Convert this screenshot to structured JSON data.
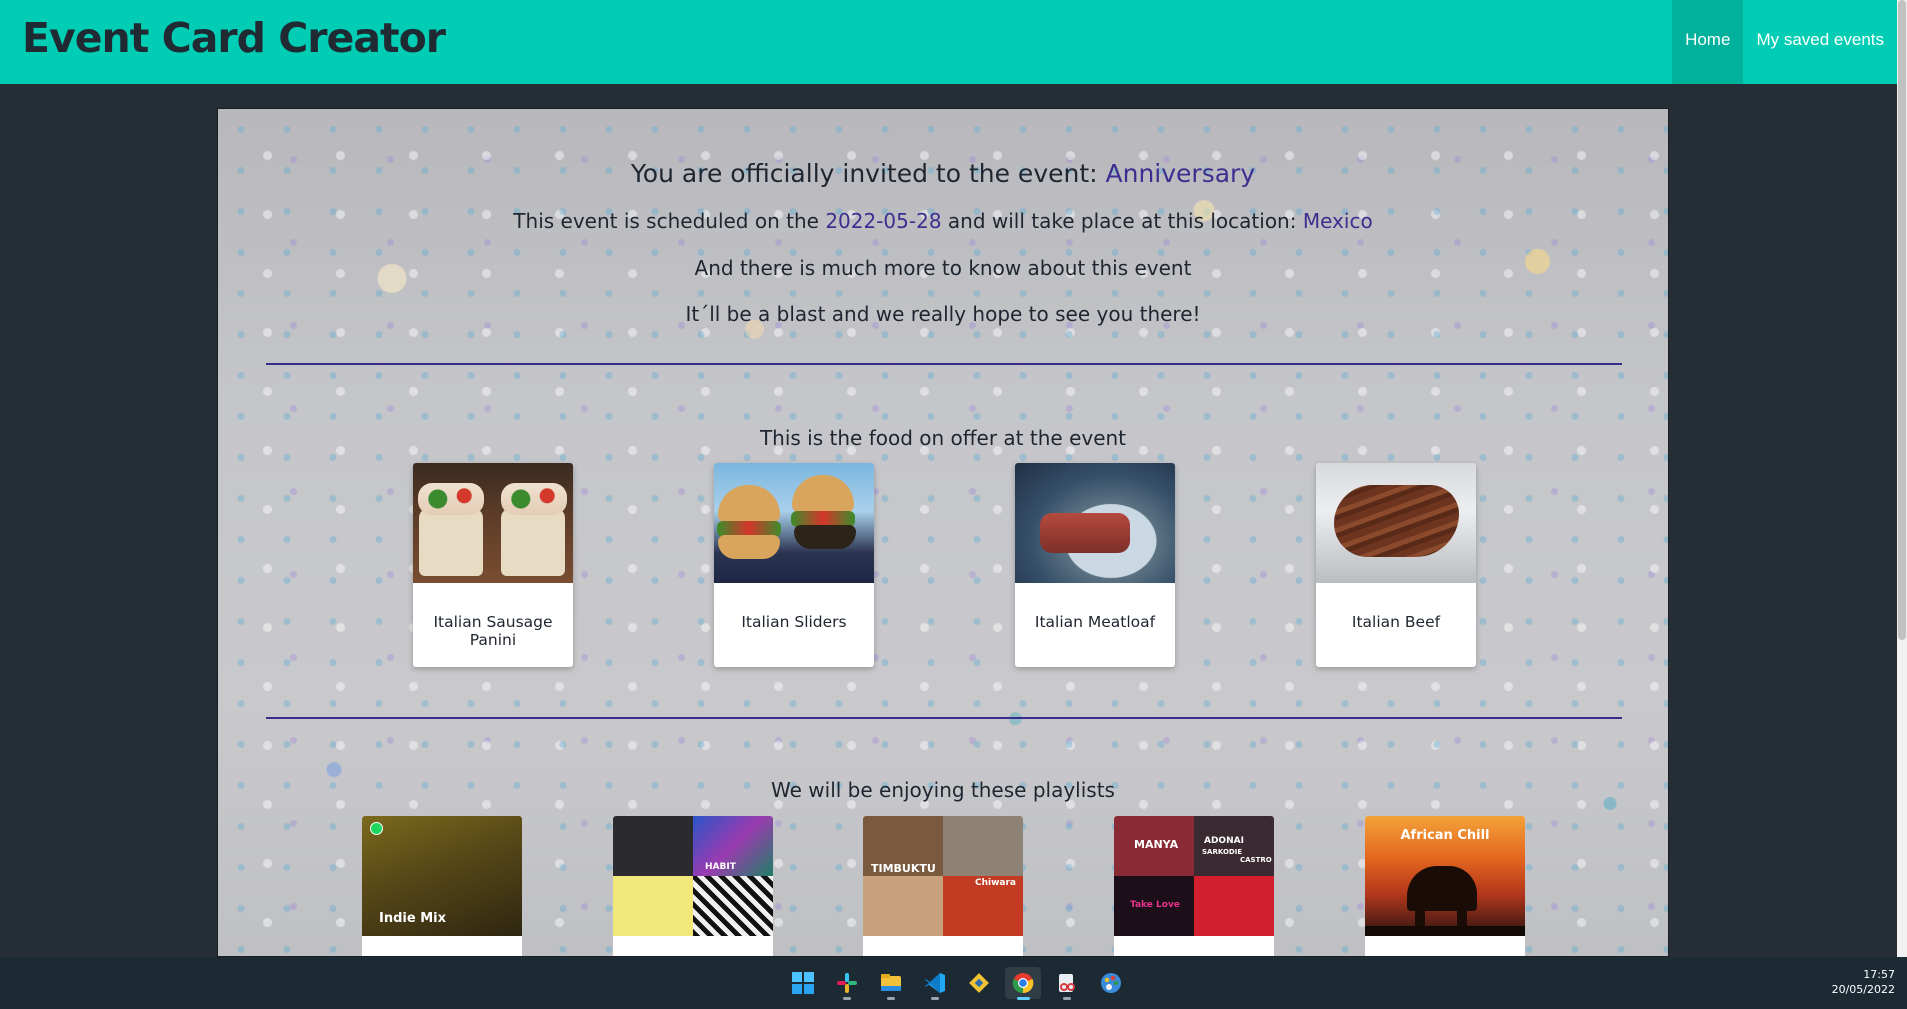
{
  "header": {
    "brand": "Event Card Creator",
    "nav": [
      {
        "label": "Home",
        "active": true
      },
      {
        "label": "My saved events",
        "active": false
      }
    ],
    "color": "#00cdb4"
  },
  "invitation": {
    "intro": "You are officially invited to the event:",
    "event_name": "Anniversary",
    "schedule_prefix": "This event is scheduled on the",
    "date": "2022-05-28",
    "location_prefix": "and will take place at this location:",
    "location": "Mexico",
    "line3": "And there is much more to know about this event",
    "line4": "It´ll be a blast and we really hope to see you there!",
    "accent_color": "#3c2f8f"
  },
  "food": {
    "title": "This is the food on offer at the event",
    "items": [
      {
        "name": "Italian Sausage Panini"
      },
      {
        "name": "Italian Sliders"
      },
      {
        "name": "Italian Meatloaf"
      },
      {
        "name": "Italian Beef"
      }
    ]
  },
  "playlists": {
    "title": "We will be enjoying these playlists",
    "items": [
      {
        "cover_text": "Indie Mix"
      },
      {
        "cover_text": "HABIT"
      },
      {
        "cover_text": "TIMBUKTU"
      },
      {
        "cover_text": "MANYA"
      },
      {
        "cover_text": "African Chill"
      }
    ],
    "extra_cover_text": [
      "Chiwara",
      "ADONAI",
      "SARKODIE",
      "CASTRO",
      "Take Love"
    ]
  },
  "taskbar": {
    "icons": [
      "windows-start-icon",
      "slack-icon",
      "file-explorer-icon",
      "vscode-icon",
      "git-icon",
      "chrome-icon",
      "snipping-tool-icon",
      "paint-icon"
    ],
    "time": "17:57",
    "date": "20/05/2022"
  }
}
